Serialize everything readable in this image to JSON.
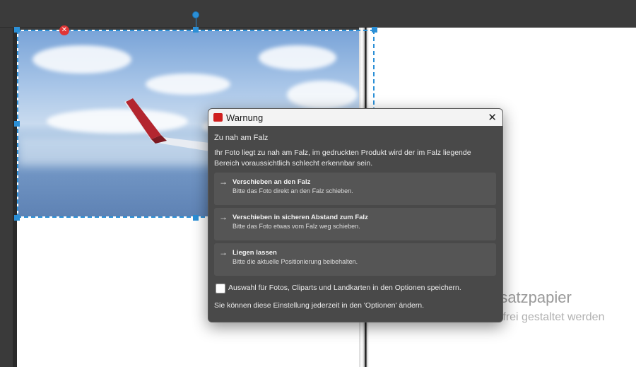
{
  "dialog": {
    "title": "Warnung",
    "close_glyph": "✕",
    "heading": "Zu nah am Falz",
    "message": "Ihr Foto liegt zu nah am Falz, im gedruckten Produkt wird der im Falz liegende Bereich voraussichtlich schlecht erkennbar sein.",
    "options": [
      {
        "title": "Verschieben an den Falz",
        "description": "Bitte das Foto direkt an den Falz schieben."
      },
      {
        "title": "Verschieben in sicheren Abstand zum Falz",
        "description": "Bitte das Foto etwas vom Falz weg schieben."
      },
      {
        "title": "Liegen lassen",
        "description": "Bitte die aktuelle Positionierung beibehalten."
      }
    ],
    "arrow_glyph": "→",
    "checkbox_label": "Auswahl für Fotos, Cliparts und Landkarten in den Optionen speichern.",
    "checkbox_checked": false,
    "footer": "Sie können diese Einstellung jederzeit in den 'Optionen' ändern."
  },
  "page": {
    "right_title": "rsatzpapier",
    "right_subtitle": "kann nicht frei gestaltet werden"
  },
  "colors": {
    "selection": "#2b8fd6",
    "delete_handle": "#e03535",
    "app_icon": "#cf1f1f"
  },
  "icons": {
    "app": "app-logo-icon",
    "close": "close-icon",
    "delete": "delete-handle-icon",
    "rotate": "rotate-handle-icon"
  }
}
